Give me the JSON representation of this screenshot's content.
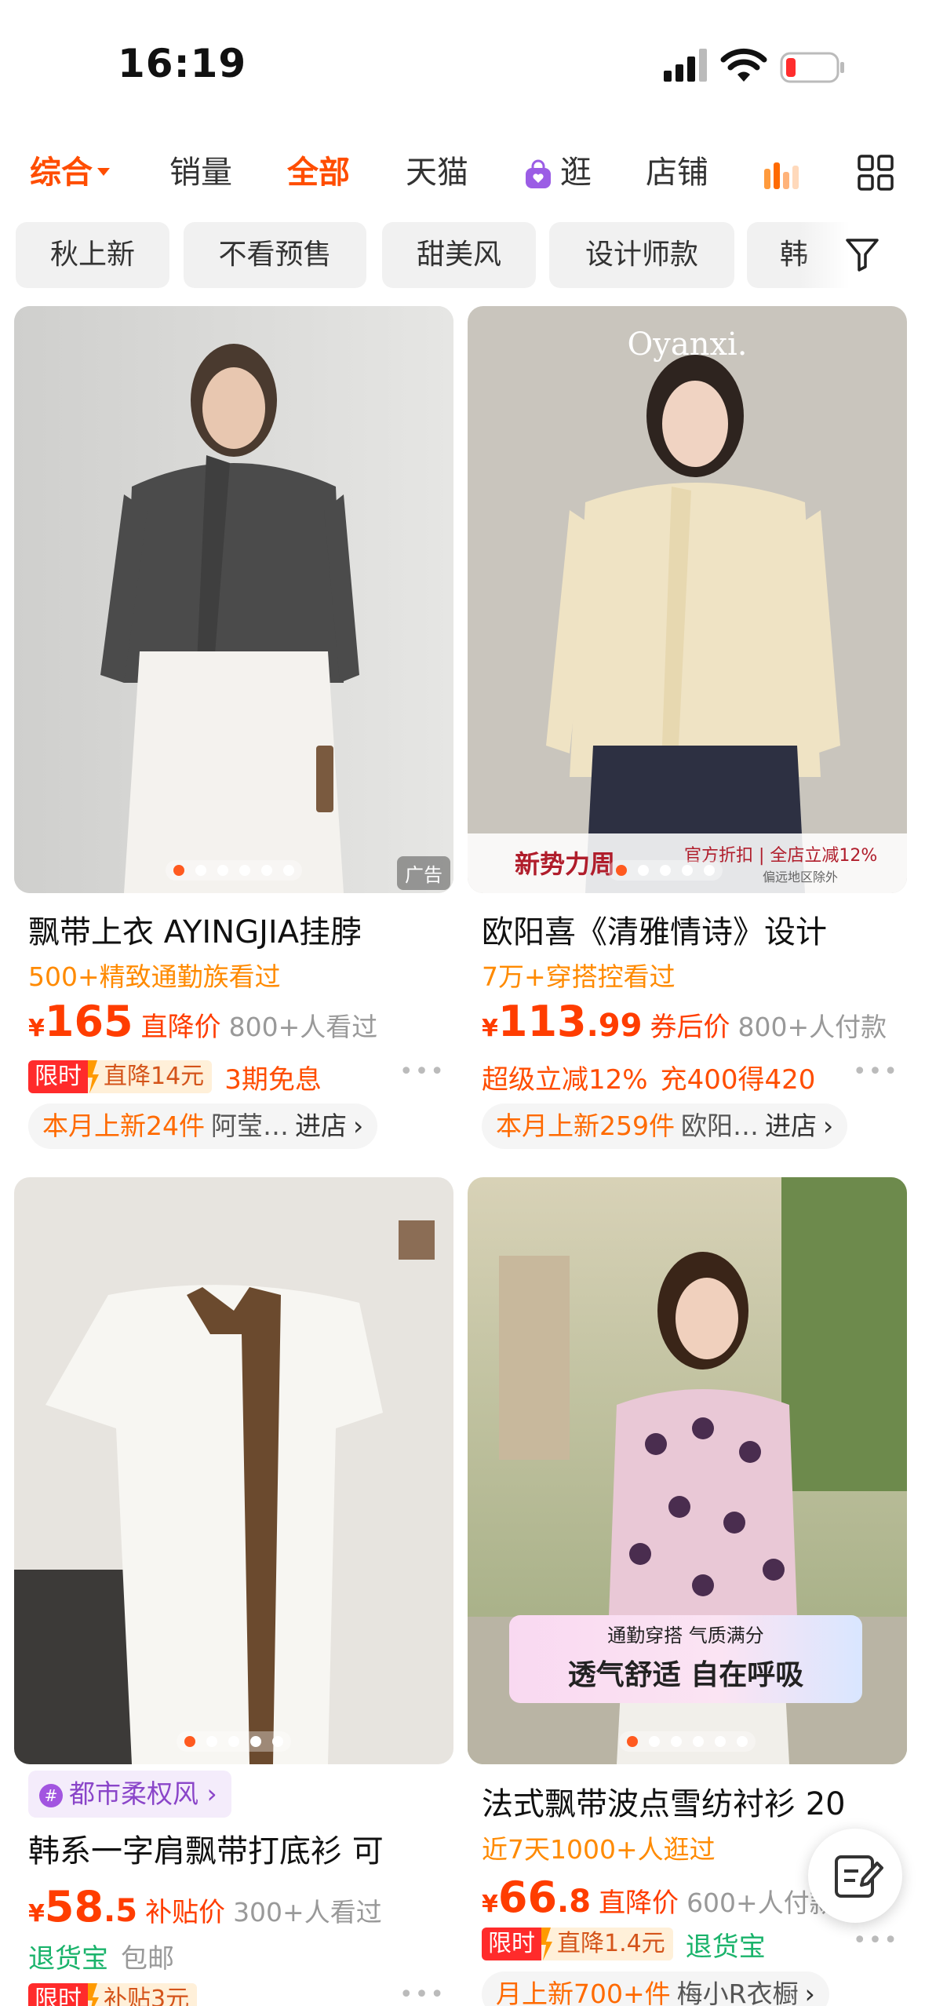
{
  "status_bar": {
    "time": "16:19"
  },
  "tabs": [
    {
      "label": "综合",
      "active": true
    },
    {
      "label": "销量"
    },
    {
      "label": "全部",
      "active": true
    },
    {
      "label": "天猫"
    },
    {
      "label": "逛"
    },
    {
      "label": "店铺"
    }
  ],
  "chips": [
    "秋上新",
    "不看预售",
    "甜美风",
    "设计师款",
    "韩"
  ],
  "products": [
    {
      "title": "飘带上衣 AYINGJIA挂脖",
      "sub": "500+精致通勤族看过",
      "currency": "¥",
      "price_int": "165",
      "price_dec": "",
      "price_label": "直降价",
      "seen": "800+人看过",
      "limit_a": "限时",
      "limit_b": "直降14元",
      "extra_tag": "3期免息",
      "shop_new": "本月上新24件",
      "shop_name": "阿莹…",
      "shop_go": "进店",
      "ad": "广告",
      "dots": 6,
      "active_dot": 0
    },
    {
      "title": "欧阳喜《清雅情诗》设计",
      "sub": "7万+穿搭控看过",
      "currency": "¥",
      "price_int": "113",
      "price_dec": ".99",
      "price_label": "券后价",
      "seen": "800+人付款",
      "tag1": "超级立减12%",
      "tag2": "充400得420",
      "shop_new": "本月上新259件",
      "shop_name": "欧阳…",
      "shop_go": "进店",
      "brand": "Oyanxi.",
      "promo_left": "新势力周",
      "promo_right": "官方折扣 | 全店立减12%",
      "promo_note": "偏远地区除外",
      "dots": 5,
      "active_dot": 0
    },
    {
      "style_tag": "都市柔权风",
      "title": "韩系一字肩飘带打底衫 可",
      "currency": "¥",
      "price_int": "58",
      "price_dec": ".5",
      "price_label": "补贴价",
      "seen": "300+人看过",
      "tag1": "退货宝",
      "tag2": "包邮",
      "limit_a": "限时",
      "limit_b": "补贴3元",
      "dots": 5,
      "active_dot": 0
    },
    {
      "title": "法式飘带波点雪纺衬衫 20",
      "sub": "近7天1000+人逛过",
      "currency": "¥",
      "price_int": "66",
      "price_dec": ".8",
      "price_label": "直降价",
      "seen": "600+人付款",
      "limit_a": "限时",
      "limit_b": "直降1.4元",
      "extra_tag": "退货宝",
      "shop_new": "月上新700+件",
      "shop_name": "梅小R衣橱",
      "banner_l1": "通勤穿搭 气质满分",
      "banner_l2": "透气舒适 自在呼吸",
      "dots": 6,
      "active_dot": 0
    }
  ],
  "colors": {
    "accent": "#ff4d00",
    "price": "#ff3d00",
    "sub": "#ff8a00",
    "green": "#1ab36b"
  }
}
